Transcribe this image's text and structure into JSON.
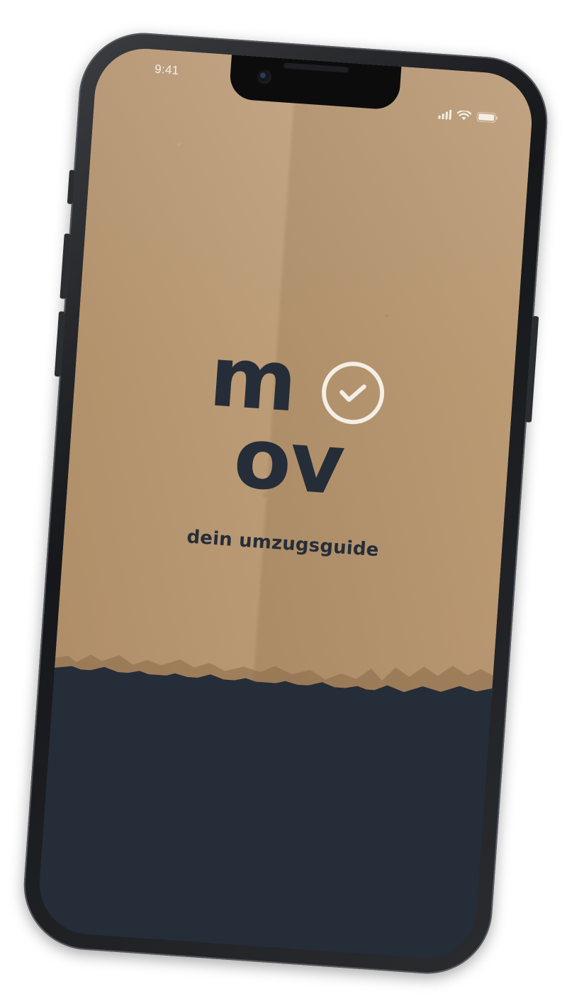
{
  "status_bar": {
    "time": "9:41",
    "icons": [
      "signal-icon",
      "wifi-icon",
      "battery-icon"
    ]
  },
  "app": {
    "logo_line1": "m",
    "logo_line2": "ov",
    "logo_icon": "check-circle-icon",
    "tagline": "dein umzugsguide"
  },
  "colors": {
    "navy": "#252d38",
    "cardboard": "#b8976f",
    "cream": "#f4efe6",
    "frame": "#1c1d20"
  }
}
